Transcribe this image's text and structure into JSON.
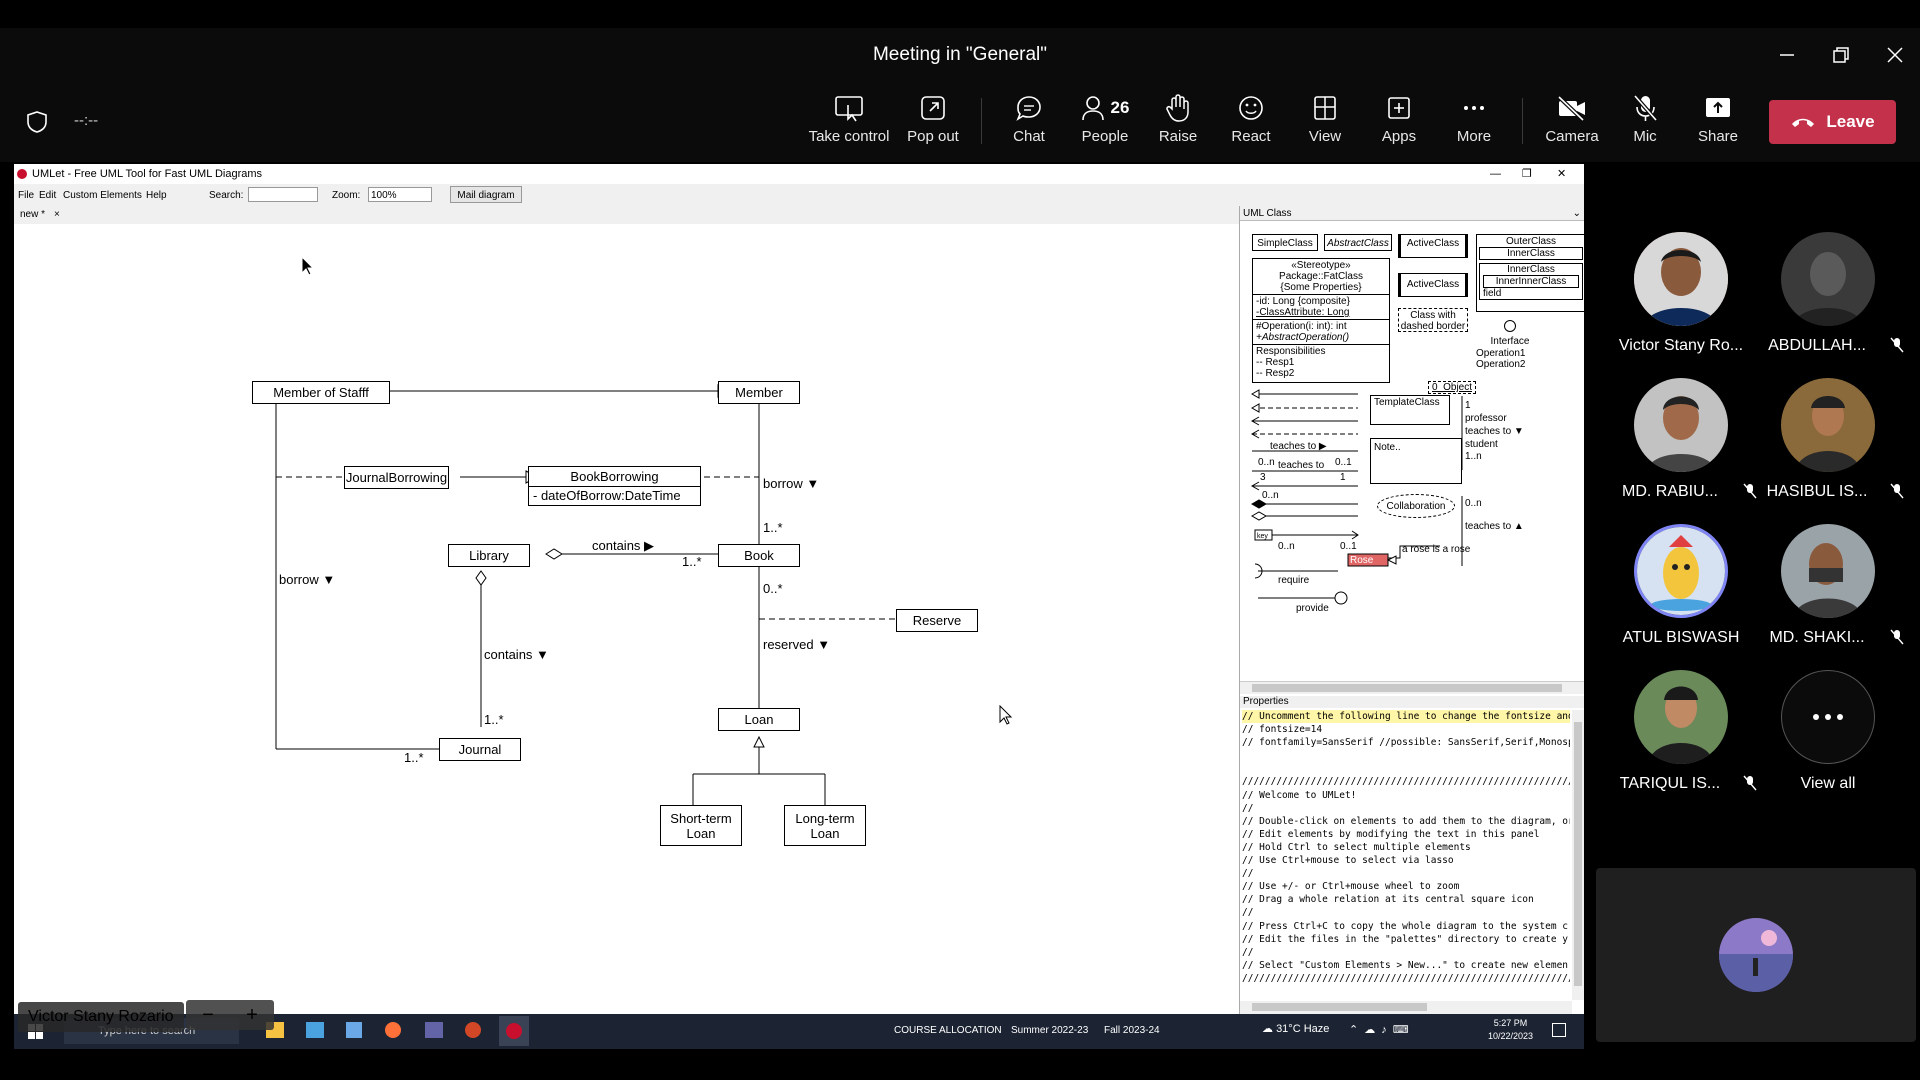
{
  "window": {
    "title": "Meeting in \"General\""
  },
  "toolbar": {
    "timer": "--:--",
    "take_control": "Take control",
    "pop_out": "Pop out",
    "chat": "Chat",
    "people": "People",
    "people_count": "26",
    "raise": "Raise",
    "react": "React",
    "view": "View",
    "apps": "Apps",
    "more": "More",
    "camera": "Camera",
    "mic": "Mic",
    "share": "Share",
    "leave": "Leave",
    "leave_color": "#c4314b"
  },
  "umlet": {
    "title": "UMLet - Free UML Tool for Fast UML Diagrams",
    "menu": [
      "File",
      "Edit",
      "Custom Elements",
      "Help"
    ],
    "search_label": "Search:",
    "zoom_label": "Zoom:",
    "zoom_value": "100%",
    "mail_button": "Mail diagram",
    "tab": "new *",
    "tab_close": "×",
    "palette_title": "UML Class",
    "properties_title": "Properties"
  },
  "diagram": {
    "member_of_staff": "Member of Stafff",
    "member": "Member",
    "journal_borrowing": "JournalBorrowing",
    "book_borrowing": "BookBorrowing",
    "book_borrowing_attr": "- dateOfBorrow:DateTime",
    "library": "Library",
    "book": "Book",
    "reserve": "Reserve",
    "loan": "Loan",
    "journal": "Journal",
    "short_term_loan": "Short-term Loan",
    "long_term_loan": "Long-term Loan",
    "borrow_right": "borrow ▼",
    "borrow_left": "borrow ▼",
    "contains_top": "contains ▶",
    "contains_mid": "contains ▼",
    "reserved": "reserved ▼",
    "mult_1star_member": "1..*",
    "mult_1star_book": "1..*",
    "mult_0star": "0..*",
    "mult_1star_journal": "1..*",
    "mult_1star_journal2": "1..*"
  },
  "palette": {
    "simple_class": "SimpleClass",
    "abstract_class": "AbstractClass",
    "active_class": "ActiveClass",
    "active_class2": "ActiveClass",
    "outer_class": "OuterClass",
    "inner_class": "InnerClass",
    "inner_class2": "InnerClass",
    "inner_inner_class": "InnerInnerClass",
    "field": "field",
    "fat_class": [
      "«Stereotype»",
      "Package::FatClass",
      "{Some Properties}"
    ],
    "fat_attrs": [
      "-id: Long {composite}",
      "-ClassAttribute: Long"
    ],
    "fat_ops": [
      "#Operation(i: int): int",
      "+AbstractOperation()"
    ],
    "fat_resp": [
      "Responsibilities",
      "-- Resp1",
      "-- Resp2"
    ],
    "dashed_class": "Class with dashed border",
    "interface": "Interface",
    "interface_ops": [
      "Operation1",
      "Operation2"
    ],
    "object": "0_Object",
    "template": "TemplateClass",
    "note": "Note..",
    "collaboration": "Collaboration",
    "teaches_to1": "teaches to ▶",
    "teaches_to2": "teaches to",
    "mult_0n": "0..n",
    "mult_01": "0..1",
    "mult_3": "3",
    "mult_1": "1",
    "mult_0n2": "0..n",
    "key": "key",
    "mult_0n3": "0..n",
    "mult_01b": "0..1",
    "require": "require",
    "provide": "provide",
    "rose": "Rose",
    "rose_note": "a rose is a rose",
    "assoc_1": "1",
    "assoc_prof": "professor",
    "assoc_teaches": "teaches to ▼",
    "assoc_student": "student",
    "assoc_1n": "1..n",
    "assoc_0n": "0..n",
    "assoc_teaches2": "teaches to ▲"
  },
  "properties_lines": [
    "// Uncomment the following line to change the fontsize and",
    "// fontsize=14",
    "// fontfamily=SansSerif //possible: SansSerif,Serif,Monosp",
    "",
    "",
    "//////////////////////////////////////////////////////////",
    "// Welcome to UMLet!",
    "//",
    "// Double-click on elements to add them to the diagram, or",
    "// Edit elements by modifying the text in this panel",
    "// Hold Ctrl to select multiple elements",
    "// Use Ctrl+mouse to select via lasso",
    "//",
    "// Use +/- or Ctrl+mouse wheel to zoom",
    "// Drag a whole relation at its central square icon",
    "//",
    "// Press Ctrl+C to copy the whole diagram to the system c",
    "// Edit the files in the \"palettes\" directory to create y",
    "//",
    "// Select \"Custom Elements > New...\" to create new elemen",
    "//////////////////////////////////////////////////////////"
  ],
  "taskbar": {
    "search": "Type here to search",
    "items": [
      "COURSE ALLOCATION",
      "Summer 2022-23",
      "Fall 2023-24"
    ],
    "weather": "31°C Haze",
    "time": "5:27 PM",
    "date": "10/22/2023",
    "presenter": "Victor Stany Rozario"
  },
  "participants": [
    {
      "name": "Victor Stany Ro...",
      "muted": false
    },
    {
      "name": "ABDULLAH...",
      "muted": true
    },
    {
      "name": "MD. RABIU...",
      "muted": true
    },
    {
      "name": "HASIBUL IS...",
      "muted": true
    },
    {
      "name": "ATUL BISWASH",
      "muted": false
    },
    {
      "name": "MD. SHAKI...",
      "muted": true
    },
    {
      "name": "TARIQUL IS...",
      "muted": true
    },
    {
      "name": "View all",
      "muted": false
    }
  ]
}
